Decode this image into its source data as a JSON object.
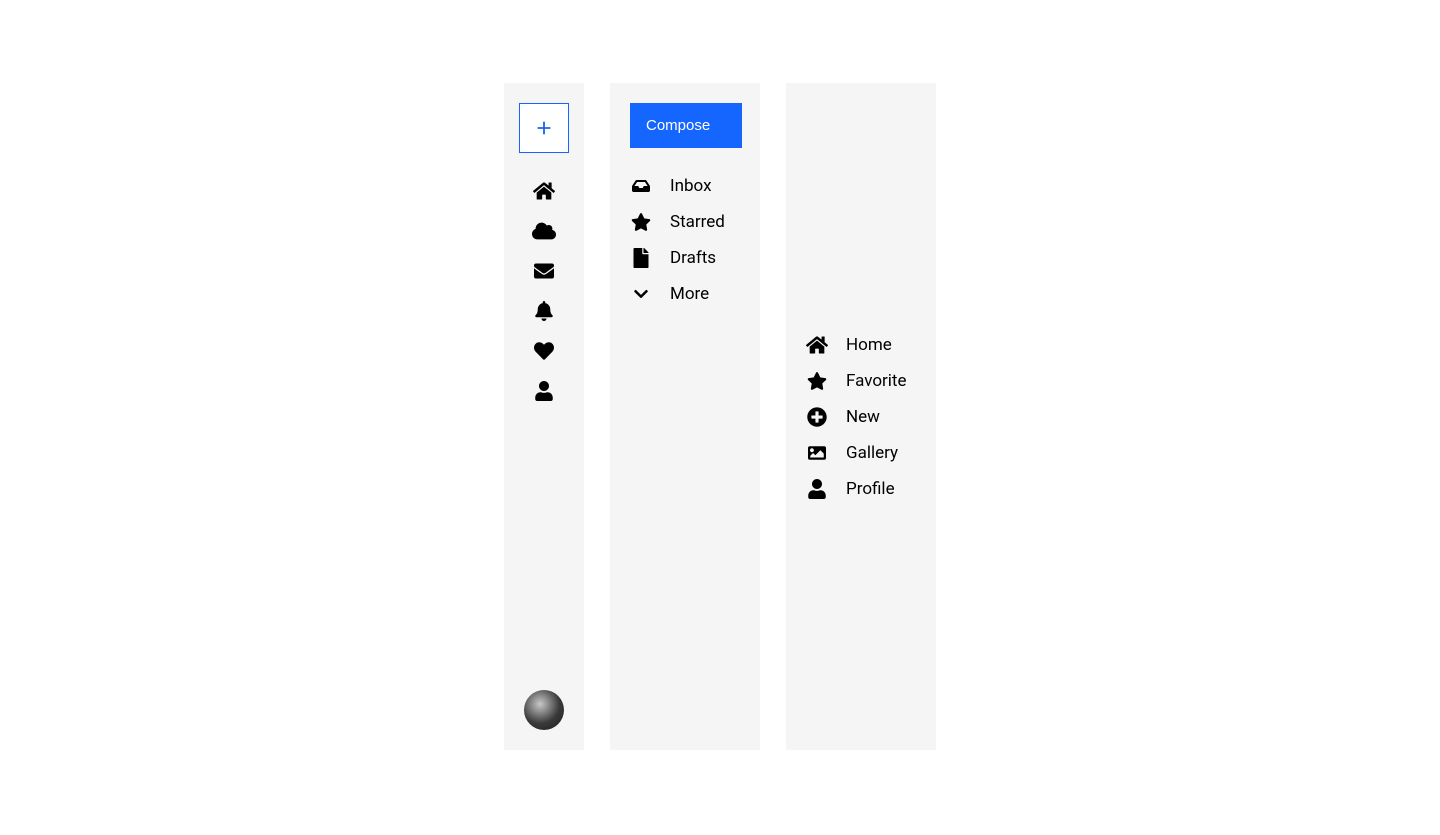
{
  "panel1": {
    "icons": [
      "home",
      "cloud",
      "envelope",
      "bell",
      "heart",
      "user"
    ]
  },
  "panel2": {
    "compose_label": "Compose",
    "items": [
      {
        "icon": "inbox",
        "label": "Inbox"
      },
      {
        "icon": "star",
        "label": "Starred"
      },
      {
        "icon": "file",
        "label": "Drafts"
      },
      {
        "icon": "chevron-down",
        "label": "More"
      }
    ]
  },
  "panel3": {
    "items": [
      {
        "icon": "home",
        "label": "Home"
      },
      {
        "icon": "star",
        "label": "Favorite"
      },
      {
        "icon": "plus-circle",
        "label": "New"
      },
      {
        "icon": "image",
        "label": "Gallery"
      },
      {
        "icon": "user",
        "label": "Profile"
      }
    ]
  },
  "colors": {
    "accent": "#1565ff",
    "panel_bg": "#f5f5f5"
  }
}
